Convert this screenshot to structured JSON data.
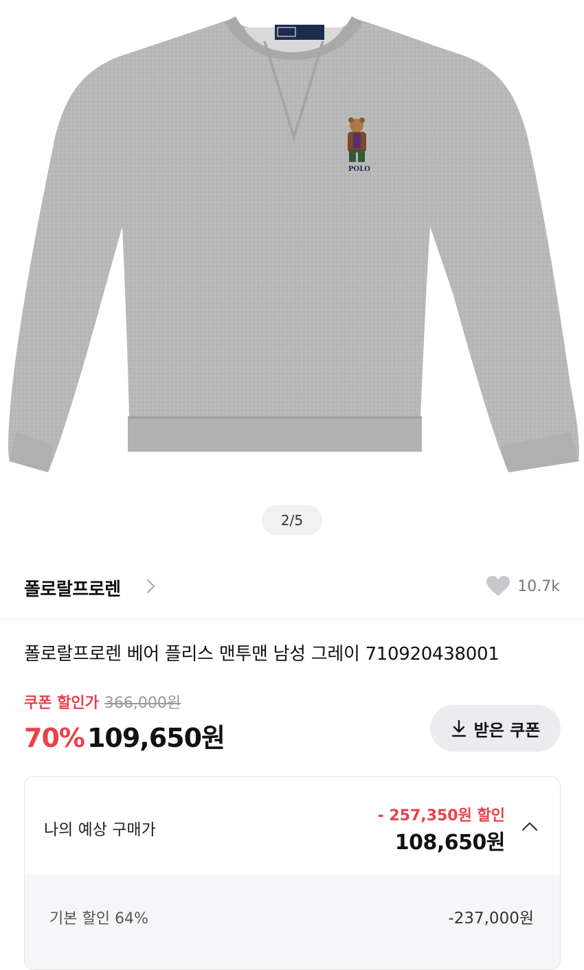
{
  "gallery": {
    "counter": "2/5",
    "logo_text": "POLO"
  },
  "brand": {
    "name": "폴로랄프로렌",
    "likes": "10.7k"
  },
  "product": {
    "name": "폴로랄프로렌 베어 플리스 맨투맨 남성 그레이 710920438001"
  },
  "price": {
    "coupon_label": "쿠폰 할인가",
    "original": "366,000원",
    "discount_rate": "70%",
    "final": "109,650원",
    "coupon_button": "받은 쿠폰"
  },
  "estimate": {
    "title": "나의 예상 구매가",
    "discount": "- 257,350원 할인",
    "price": "108,650원",
    "rows": [
      {
        "label": "기본 할인 64%",
        "value": "-237,000원"
      }
    ]
  },
  "colors": {
    "accent": "#e8424a",
    "sweater": "#b9b9b9"
  }
}
